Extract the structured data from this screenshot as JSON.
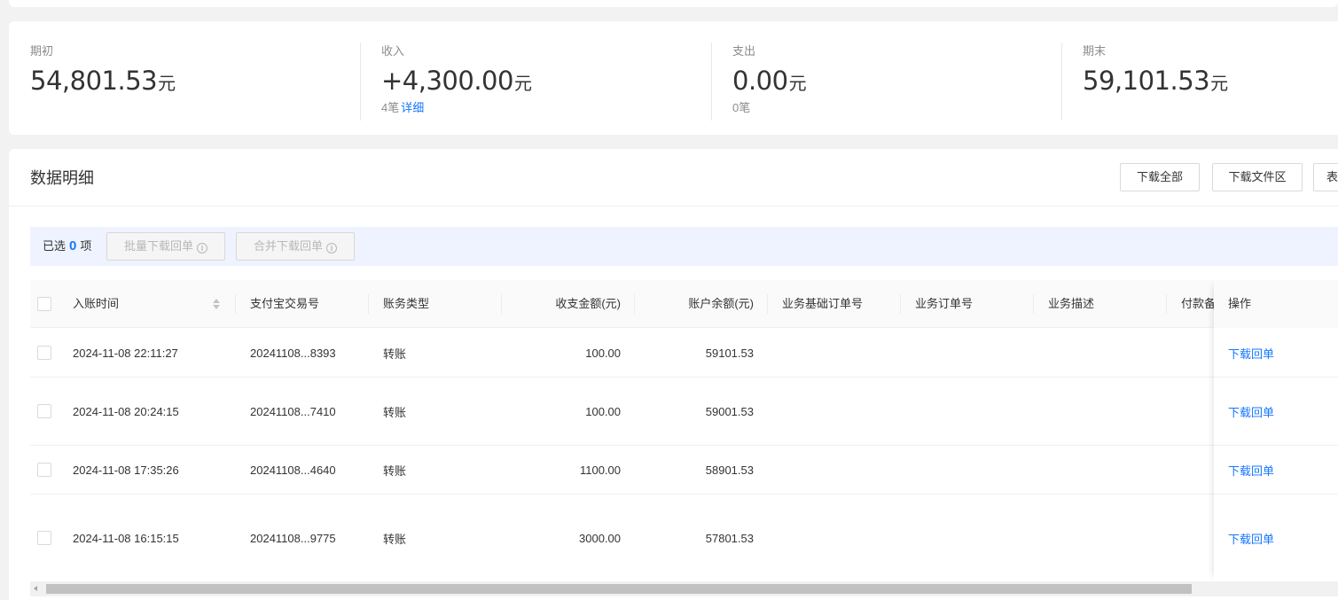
{
  "summary": {
    "opening": {
      "label": "期初",
      "value": "54,801.53",
      "unit": "元"
    },
    "income": {
      "label": "收入",
      "value": "+4,300.00",
      "unit": "元",
      "count": "4笔",
      "detail_link": "详细"
    },
    "expense": {
      "label": "支出",
      "value": "0.00",
      "unit": "元",
      "count": "0笔"
    },
    "closing": {
      "label": "期末",
      "value": "59,101.53",
      "unit": "元"
    }
  },
  "detail": {
    "title": "数据明细",
    "buttons": {
      "download_all": "下载全部",
      "download_area": "下载文件区",
      "more": "表"
    }
  },
  "selection": {
    "prefix": "已选",
    "count": "0",
    "suffix": "项",
    "batch_download": "批量下载回单",
    "merge_download": "合并下载回单",
    "info_glyph": "i"
  },
  "table": {
    "headers": {
      "time": "入账时间",
      "trade_no": "支付宝交易号",
      "type": "账务类型",
      "amount": "收支金额(元)",
      "balance": "账户余额(元)",
      "base_order": "业务基础订单号",
      "order": "业务订单号",
      "desc": "业务描述",
      "payment": "付款备",
      "action": "操作"
    },
    "rows": [
      {
        "time": "2024-11-08 22:11:27",
        "trade_no": "20241108...8393",
        "type": "转账",
        "amount": "100.00",
        "balance": "59101.53",
        "action": "下载回单"
      },
      {
        "time": "2024-11-08 20:24:15",
        "trade_no": "20241108...7410",
        "type": "转账",
        "amount": "100.00",
        "balance": "59001.53",
        "action": "下载回单"
      },
      {
        "time": "2024-11-08 17:35:26",
        "trade_no": "20241108...4640",
        "type": "转账",
        "amount": "1100.00",
        "balance": "58901.53",
        "action": "下载回单"
      },
      {
        "time": "2024-11-08 16:15:15",
        "trade_no": "20241108...9775",
        "type": "转账",
        "amount": "3000.00",
        "balance": "57801.53",
        "action": "下载回单"
      }
    ]
  },
  "colors": {
    "accent": "#1677ff",
    "selection_bar": "#eef3ff",
    "page_bg": "#f2f2f2"
  },
  "icons": {
    "sort": "sort-icon",
    "info": "info-icon",
    "scroll_left": "chevron-left-icon"
  }
}
